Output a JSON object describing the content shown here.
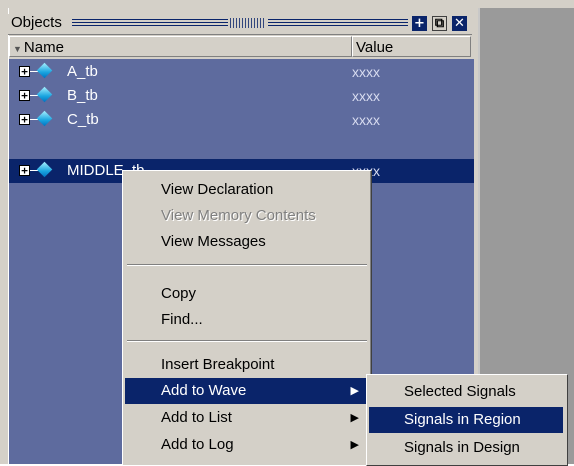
{
  "window": {
    "title": "Objects",
    "buttons": [
      "add-icon",
      "dock-icon",
      "close-icon"
    ]
  },
  "columns": {
    "name": "Name",
    "value": "Value"
  },
  "rows": [
    {
      "name": "A_tb",
      "value": "xxxx"
    },
    {
      "name": "B_tb",
      "value": "xxxx"
    },
    {
      "name": "C_tb",
      "value": "xxxx"
    },
    {
      "name": "MIDDLE_tb",
      "value": "xxxx",
      "selected": true
    }
  ],
  "context_menu": {
    "items": [
      {
        "label": "View Declaration",
        "enabled": true
      },
      {
        "label": "View Memory Contents",
        "enabled": false
      },
      {
        "label": "View Messages",
        "enabled": true
      },
      {
        "label": "Copy",
        "enabled": true
      },
      {
        "label": "Find...",
        "enabled": true
      },
      {
        "label": "Insert Breakpoint",
        "enabled": true
      },
      {
        "label": "Add to Wave",
        "enabled": true,
        "highlighted": true,
        "submenu": true
      },
      {
        "label": "Add to List",
        "enabled": true,
        "submenu": true
      },
      {
        "label": "Add to Log",
        "enabled": true,
        "submenu": true
      }
    ]
  },
  "submenu": {
    "items": [
      {
        "label": "Selected Signals"
      },
      {
        "label": "Signals in Region",
        "highlighted": true
      },
      {
        "label": "Signals in Design"
      }
    ]
  },
  "colors": {
    "selection": "#0a246a",
    "list_background": "#5e6b9e",
    "menu_background": "#d4d0c8"
  }
}
